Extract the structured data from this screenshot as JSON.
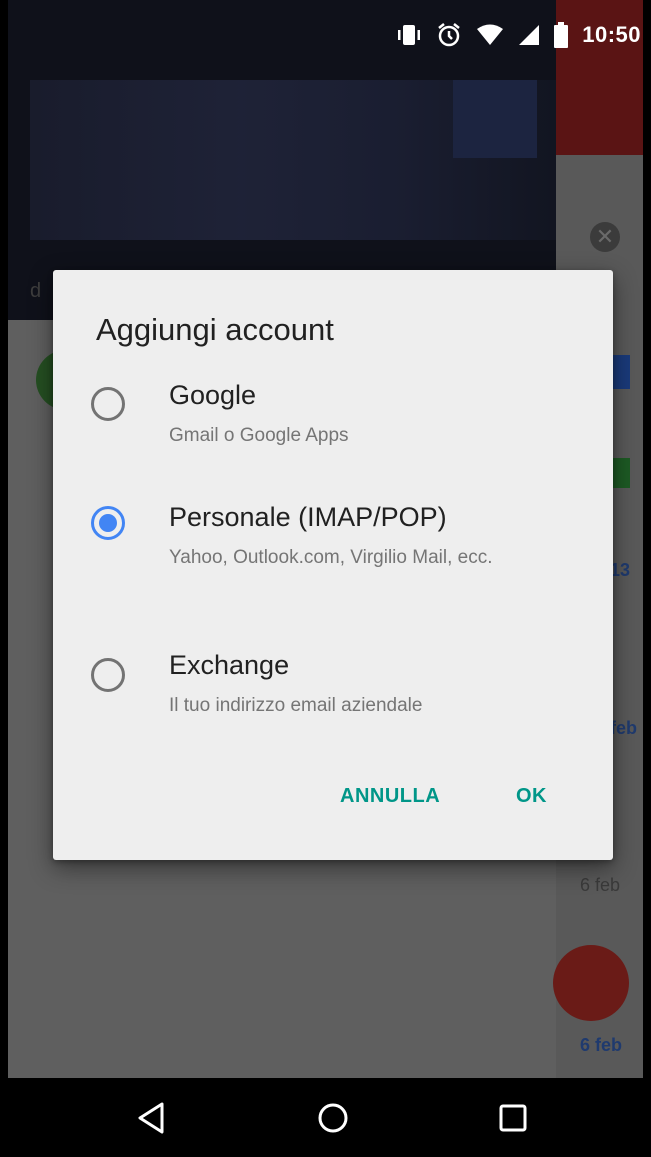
{
  "status_bar": {
    "time": "10:50",
    "icons": [
      "vibrate-icon",
      "alarm-icon",
      "wifi-icon",
      "signal-icon",
      "battery-icon"
    ]
  },
  "background": {
    "drawer_initial": "d",
    "dates": [
      "13",
      "feb",
      "6 feb",
      "6 feb"
    ]
  },
  "dialog": {
    "title": "Aggiungi account",
    "options": [
      {
        "label": "Google",
        "subtitle": "Gmail o Google Apps",
        "selected": false
      },
      {
        "label": "Personale (IMAP/POP)",
        "subtitle": "Yahoo, Outlook.com, Virgilio Mail, ecc.",
        "selected": true
      },
      {
        "label": "Exchange",
        "subtitle": "Il tuo indirizzo email aziendale",
        "selected": false
      }
    ],
    "cancel_label": "ANNULLA",
    "ok_label": "OK"
  },
  "nav_bar": {
    "buttons": [
      "back-icon",
      "home-icon",
      "recents-icon"
    ]
  },
  "colors": {
    "accent": "#009688",
    "radio_selected": "#4285f4",
    "radio_unselected": "#737373",
    "dialog_bg": "#eeeeee"
  }
}
